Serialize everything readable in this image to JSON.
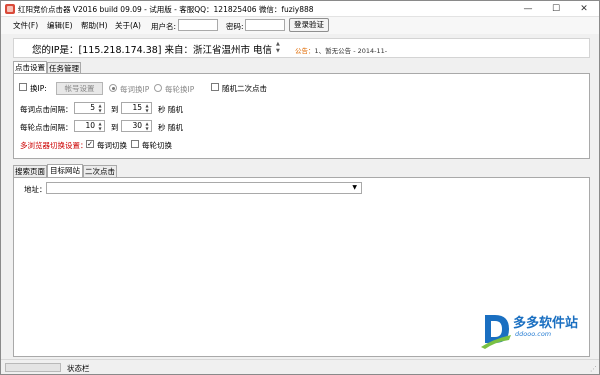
{
  "window": {
    "title": "红阳竞价点击器 V2016 build 09.09 - 试用版 - 客服QQ：121825406 微信：fuziy888",
    "min_label": "—",
    "max_label": "☐",
    "close_label": "✕"
  },
  "menubar": {
    "items": [
      "文件(F)",
      "编辑(E)",
      "帮助(H)",
      "关于(A)"
    ],
    "username_label": "用户名:",
    "password_label": "密码:",
    "login_button": "登录验证"
  },
  "ip_info": {
    "text": "您的IP是：[115.218.174.38] 来自：浙江省温州市 电信",
    "notice_label": "公告：",
    "notice_text": "1、暂无公告 - 2014-11-"
  },
  "top_tabs": [
    "点击设置",
    "任务管理"
  ],
  "settings": {
    "change_ip_label": "换IP:",
    "account_settings_button": "帐号设置",
    "radio_per_word": "每词换IP",
    "radio_per_round": "每轮换IP",
    "random_second_click": "随机二次点击",
    "per_word_interval_label": "每词点击间隔：",
    "per_word_from": "5",
    "per_word_to": "15",
    "per_round_interval_label": "每轮点击间隔：",
    "per_round_from": "10",
    "per_round_to": "30",
    "to_label": "到",
    "unit_label": "秒 随机",
    "multi_browser_label": "多浏览器切换设置：",
    "per_word_switch": "每词切换",
    "per_round_switch": "每轮切换",
    "per_word_switch_checked": true,
    "per_round_switch_checked": false,
    "radio_selected": "每词换IP",
    "colors": {
      "warning_red": "#cc0000",
      "notice_orange": "#e06a00"
    }
  },
  "bottom_tabs": [
    "搜索页面",
    "目标网站",
    "二次点击"
  ],
  "address": {
    "label": "地址：",
    "value": ""
  },
  "watermark": {
    "brand": "多多软件站",
    "url": "ddooo.com"
  },
  "statusbar": {
    "text": "状态栏"
  }
}
